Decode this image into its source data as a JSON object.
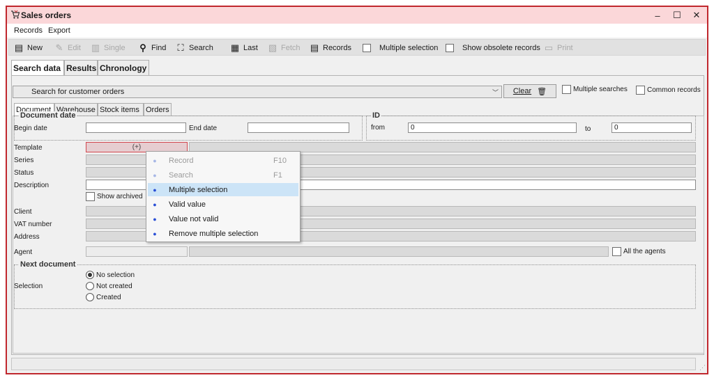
{
  "window": {
    "title": "Sales orders",
    "controls": {
      "minimize": "–",
      "maximize": "☐",
      "close": "✕"
    }
  },
  "menu": [
    "Records",
    "Export"
  ],
  "toolbar": {
    "new": "New",
    "edit": "Edit",
    "single": "Single",
    "find": "Find",
    "search": "Search",
    "last": "Last",
    "fetch": "Fetch",
    "records": "Records",
    "multiple_selection": "Multiple selection",
    "show_obsolete": "Show obsolete records",
    "print": "Print"
  },
  "main_tabs": [
    "Search data",
    "Results",
    "Chronology"
  ],
  "search_combo": {
    "value": "Search for customer orders"
  },
  "clear_button": "Clear",
  "checks": {
    "multiple_searches": "Multiple searches",
    "common_records": "Common records"
  },
  "sub_tabs": [
    "Document",
    "Warehouse",
    "Stock items",
    "Orders"
  ],
  "document_date": {
    "title": "Document date",
    "begin_label": "Begin date",
    "begin_value": "",
    "end_label": "End date",
    "end_value": ""
  },
  "id_group": {
    "title": "ID",
    "from_label": "from",
    "from_value": "0",
    "to_label": "to",
    "to_value": "0"
  },
  "fields": {
    "template": "Template",
    "template_value": "(+)",
    "series": "Series",
    "status": "Status",
    "description": "Description",
    "show_archived": "Show archived",
    "client": "Client",
    "vat_number": "VAT number",
    "address": "Address",
    "agent": "Agent",
    "all_agents": "All the agents"
  },
  "next_document": {
    "title": "Next document",
    "selection_label": "Selection",
    "options": [
      "No selection",
      "Not created",
      "Created"
    ],
    "selected": "No selection"
  },
  "context_menu": [
    {
      "label": "Record",
      "shortcut": "F10",
      "enabled": false
    },
    {
      "label": "Search",
      "shortcut": "F1",
      "enabled": false
    },
    {
      "label": "Multiple selection",
      "shortcut": "",
      "enabled": true,
      "highlighted": true
    },
    {
      "label": "Valid value",
      "shortcut": "",
      "enabled": true
    },
    {
      "label": "Value not valid",
      "shortcut": "",
      "enabled": true
    },
    {
      "label": "Remove multiple selection",
      "shortcut": "",
      "enabled": true
    }
  ],
  "colors": {
    "titlebar": "#fbd7d9",
    "border": "#c0272d",
    "menu_highlight": "#cce4f7",
    "bullet": "#2a4fd6"
  }
}
